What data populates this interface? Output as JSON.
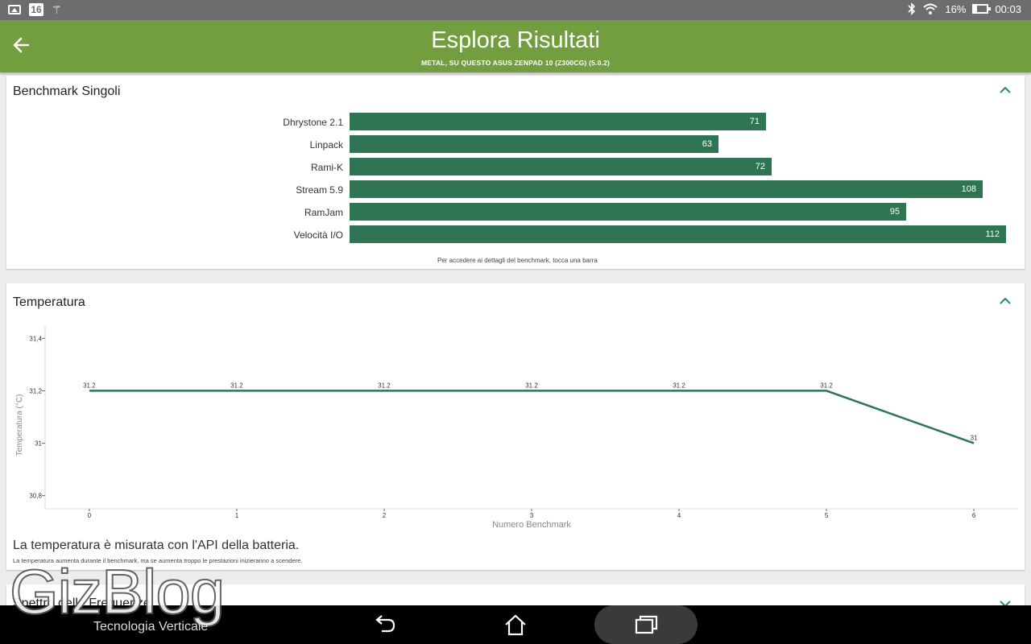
{
  "status_bar": {
    "calendar_day": "16",
    "battery_percent": "16%",
    "time": "00:03",
    "icons": [
      "image-icon",
      "calendar-icon",
      "wand-icon",
      "bluetooth-icon",
      "wifi-icon",
      "battery-icon"
    ]
  },
  "header": {
    "title": "Esplora Risultati",
    "subtitle": "METAL, SU QUESTO ASUS ZENPAD 10 (Z300CG) (5.0.2)",
    "back_icon": "arrow-left-icon",
    "background": "#739e3f"
  },
  "benchmarks": {
    "title": "Benchmark Singoli",
    "hint": "Per accedere ai dettagli del benchmark, tocca una barra",
    "bar_color": "#2f7553",
    "items": [
      {
        "label": "Dhrystone 2.1",
        "value": "71"
      },
      {
        "label": "Linpack",
        "value": "63"
      },
      {
        "label": "Rami-K",
        "value": "72"
      },
      {
        "label": "Stream 5.9",
        "value": "108"
      },
      {
        "label": "RamJam",
        "value": "95"
      },
      {
        "label": "Velocità I/O",
        "value": "112"
      }
    ]
  },
  "temperature": {
    "title": "Temperatura",
    "note": "La temperatura è misurata con l'API della batteria.",
    "subnote": "La temperatura aumenta durante il benchmark, ma se aumenta troppo le prestazioni inizieranno a scendere."
  },
  "frequency": {
    "title": "Spettro delle Frequenze"
  },
  "watermark": {
    "logo": "GizBlog",
    "tagline": "Tecnologia Verticale"
  },
  "nav": {
    "icons": [
      "back-icon",
      "home-icon",
      "recent-apps-icon"
    ]
  },
  "chart_data": {
    "type": "line",
    "xlabel": "Numero Benchmark",
    "ylabel": "Temperatura (°C)",
    "x": [
      0,
      1,
      2,
      3,
      4,
      5,
      6
    ],
    "series": [
      {
        "values": [
          31.2,
          31.2,
          31.2,
          31.2,
          31.2,
          31.2,
          31
        ]
      }
    ],
    "point_labels": [
      "31.2",
      "31.2",
      "31.2",
      "31.2",
      "31.2",
      "31.2",
      "31"
    ],
    "xticks": [
      "0",
      "1",
      "2",
      "3",
      "4",
      "5",
      "6"
    ],
    "yticks": [
      {
        "value": 31.4,
        "label": "31,4"
      },
      {
        "value": 31.2,
        "label": "31,2"
      },
      {
        "value": 31,
        "label": "31"
      },
      {
        "value": 30.8,
        "label": "30,8"
      }
    ],
    "ylim": [
      30.75,
      31.45
    ],
    "xlim": [
      -0.3,
      6.3
    ],
    "grid": false,
    "line_color": "#2f7553"
  }
}
